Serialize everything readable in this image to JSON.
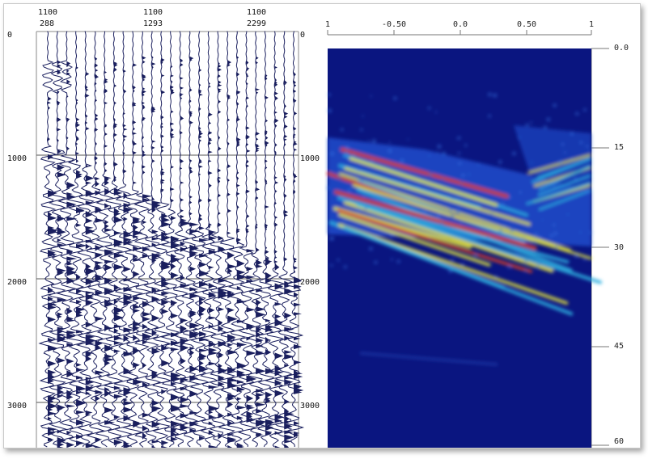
{
  "gather_panel": {
    "header_columns": [
      {
        "top": "1100",
        "bottom": "288"
      },
      {
        "top": "1100",
        "bottom": "1293"
      },
      {
        "top": "1100",
        "bottom": "2299"
      }
    ],
    "left_time_labels": [
      "0",
      "1000",
      "2000",
      "3000"
    ],
    "right_time_labels": [
      "0",
      "1000",
      "2000",
      "3000"
    ],
    "trace_color": "#1a1f5e"
  },
  "spectrum_panel": {
    "top_ticks": [
      "1",
      "-0.50",
      "0.0",
      "0.50",
      "1"
    ],
    "right_ticks": [
      "0.0",
      "15",
      "30",
      "45",
      "60"
    ],
    "background_color": "#0a1580",
    "colors": {
      "low": "#0a1580",
      "mid": "#2fb0e0",
      "high": "#e8e83a",
      "peak": "#e04020"
    }
  }
}
